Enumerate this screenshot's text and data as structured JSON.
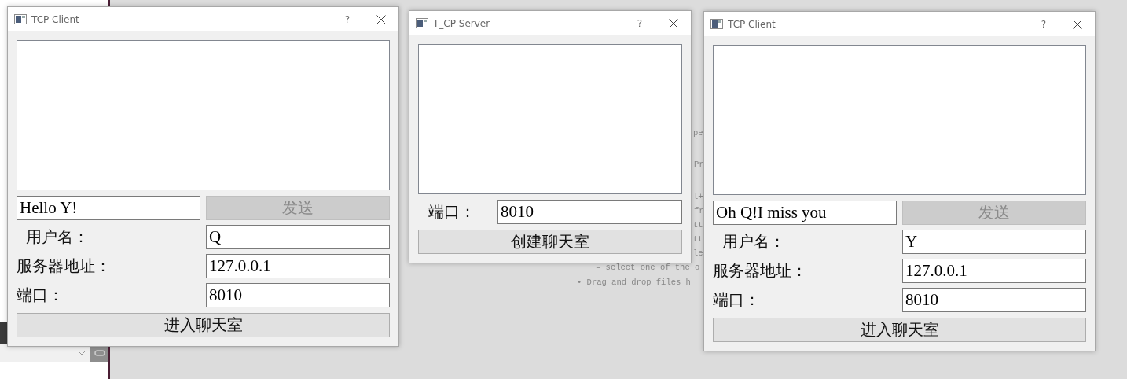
{
  "background_text": [
    "pe",
    "Pr",
    "l+",
    "fr",
    "tt",
    "tt",
    "le",
    "– select one of the o",
    "• Drag and drop files h"
  ],
  "windows": [
    {
      "kind": "client",
      "title": "TCP Client",
      "help": "?",
      "message": "Hello Y!",
      "send_button": {
        "label": "发送",
        "disabled": true
      },
      "fields": [
        {
          "label": "用户名：",
          "value": "Q"
        },
        {
          "label": "服务器地址：",
          "value": "127.0.0.1"
        },
        {
          "label": "端口：",
          "value": "8010"
        }
      ],
      "action_button": "进入聊天室"
    },
    {
      "kind": "server",
      "title": "T_CP Server",
      "help": "?",
      "fields": [
        {
          "label": "端口：",
          "value": "8010"
        }
      ],
      "action_button": "创建聊天室"
    },
    {
      "kind": "client",
      "title": "TCP Client",
      "help": "?",
      "message": "Oh Q!I miss you",
      "send_button": {
        "label": "发送",
        "disabled": true
      },
      "fields": [
        {
          "label": "用户名：",
          "value": "Y"
        },
        {
          "label": "服务器地址：",
          "value": "127.0.0.1"
        },
        {
          "label": "端口：",
          "value": "8010"
        }
      ],
      "action_button": "进入聊天室"
    }
  ]
}
